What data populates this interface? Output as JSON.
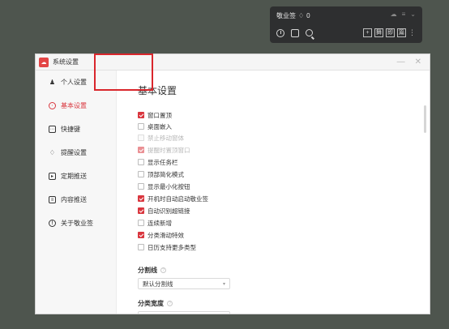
{
  "widget": {
    "title": "敬业签",
    "badge_count": "0",
    "btn_plus": "+",
    "btn_a": "舞",
    "btn_b": "即",
    "btn_c": "篇",
    "more": "⋮"
  },
  "window": {
    "title": "系统设置",
    "minimize": "—",
    "close": "✕"
  },
  "sidebar": {
    "items": [
      {
        "label": "个人设置",
        "icon": "person-icon"
      },
      {
        "label": "基本设置",
        "icon": "target-icon"
      },
      {
        "label": "快捷键",
        "icon": "keyboard-icon"
      },
      {
        "label": "提醒设置",
        "icon": "bell-icon"
      },
      {
        "label": "定期推送",
        "icon": "push-icon"
      },
      {
        "label": "内容推送",
        "icon": "content-icon"
      },
      {
        "label": "关于敬业签",
        "icon": "info-icon"
      }
    ]
  },
  "main": {
    "heading": "基本设置",
    "options": [
      {
        "label": "窗口置顶",
        "checked": true,
        "disabled": false
      },
      {
        "label": "桌面嵌入",
        "checked": false,
        "disabled": false
      },
      {
        "label": "禁止移动窗体",
        "checked": false,
        "disabled": true
      },
      {
        "label": "提醒时置顶窗口",
        "checked": true,
        "disabled": true
      },
      {
        "label": "显示任务栏",
        "checked": false,
        "disabled": false
      },
      {
        "label": "顶部简化模式",
        "checked": false,
        "disabled": false
      },
      {
        "label": "显示最小化按钮",
        "checked": false,
        "disabled": false
      },
      {
        "label": "开机时自动启动敬业签",
        "checked": true,
        "disabled": false
      },
      {
        "label": "自动识别超链接",
        "checked": true,
        "disabled": false
      },
      {
        "label": "连续新增",
        "checked": false,
        "disabled": false
      },
      {
        "label": "分类滑动特效",
        "checked": true,
        "disabled": false
      },
      {
        "label": "日历支持更多类型",
        "checked": false,
        "disabled": false
      }
    ],
    "divider_section": {
      "label": "分割线",
      "select_value": "默认分割线",
      "help": "?"
    },
    "width_section": {
      "label": "分类宽度",
      "help": "?"
    }
  },
  "colors": {
    "accent": "#d9363e",
    "highlight_box": "#d9262c"
  }
}
